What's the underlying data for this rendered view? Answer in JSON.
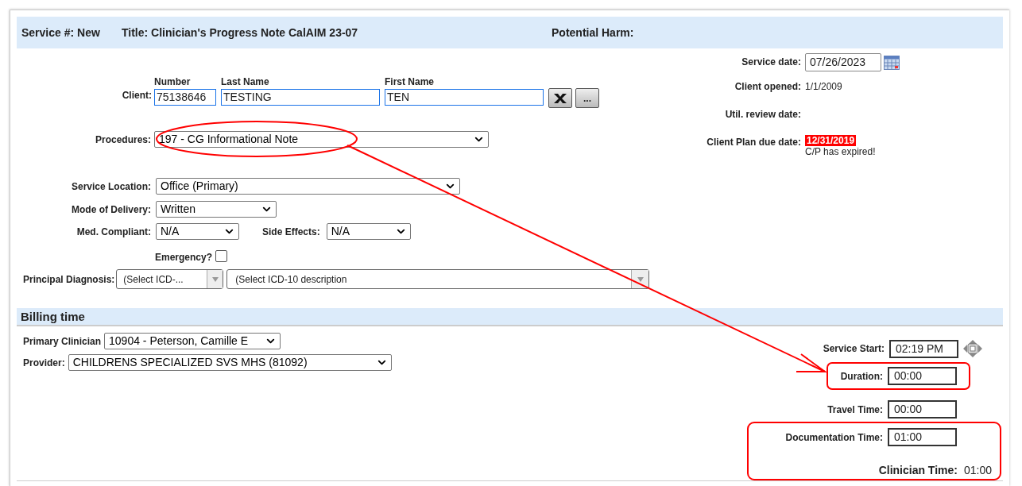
{
  "header": {
    "service": "Service #: New",
    "title": "Title: Clinician's Progress Note CalAIM 23-07",
    "harm": "Potential Harm:"
  },
  "client": {
    "label": "Client:",
    "fields": [
      {
        "heading": "Number",
        "value": "75138646"
      },
      {
        "heading": "Last Name",
        "value": "TESTING"
      },
      {
        "heading": "First Name",
        "value": "TEN"
      }
    ],
    "more": "..."
  },
  "procedures": {
    "label": "Procedures:",
    "value": "197 - CG Informational Note"
  },
  "service_location": {
    "label": "Service Location:",
    "value": "Office (Primary)"
  },
  "mode_of_delivery": {
    "label": "Mode of Delivery:",
    "value": "Written"
  },
  "med_compliant": {
    "label": "Med. Compliant:",
    "value": "N/A"
  },
  "side_effects": {
    "label": "Side Effects:",
    "value": "N/A"
  },
  "emergency": {
    "label": "Emergency?",
    "checked": false
  },
  "principal_diagnosis": {
    "label": "Principal Diagnosis:",
    "code": "(Select ICD-...",
    "description": "(Select ICD-10 description"
  },
  "dates": {
    "service_date": {
      "label": "Service date:",
      "value": "07/26/2023"
    },
    "client_opened": {
      "label": "Client opened:",
      "value": "1/1/2009"
    },
    "util_review": {
      "label": "Util. review date:"
    },
    "plan_due": {
      "label": "Client Plan due date:",
      "value": "12/31/2019",
      "expired": true,
      "note": "C/P has expired!"
    }
  },
  "billing": {
    "title": "Billing time",
    "primary_clinician": {
      "label": "Primary Clinician",
      "value": "10904 - Peterson, Camille E"
    },
    "provider": {
      "label": "Provider:",
      "value": "CHILDRENS SPECIALIZED SVS MHS (81092)"
    },
    "service_start": {
      "label": "Service Start:",
      "value": "02:19 PM"
    },
    "duration": {
      "label": "Duration:",
      "value": "00:00"
    },
    "travel_time": {
      "label": "Travel Time:",
      "value": "00:00"
    },
    "documentation_time": {
      "label": "Documentation Time:",
      "value": "01:00"
    },
    "clinician_time": {
      "label": "Clinician Time:",
      "value": "01:00"
    }
  }
}
